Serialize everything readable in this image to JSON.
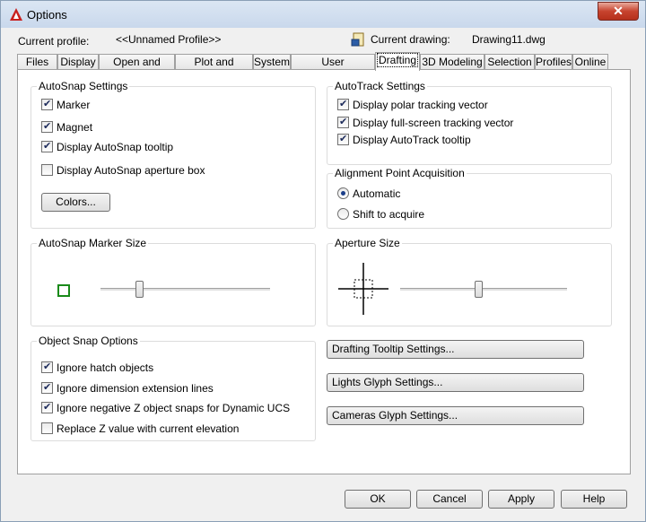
{
  "window": {
    "title": "Options",
    "close_glyph": "✕",
    "app_icon": "autocad-logo-icon"
  },
  "profile": {
    "current_profile_label": "Current profile:",
    "current_profile_value": "<<Unnamed Profile>>",
    "current_drawing_label": "Current drawing:",
    "current_drawing_value": "Drawing11.dwg"
  },
  "tabs": [
    {
      "label": "Files"
    },
    {
      "label": "Display"
    },
    {
      "label": "Open and Save"
    },
    {
      "label": "Plot and Publish"
    },
    {
      "label": "System"
    },
    {
      "label": "User Preferences"
    },
    {
      "label": "Drafting",
      "active": true
    },
    {
      "label": "3D Modeling"
    },
    {
      "label": "Selection"
    },
    {
      "label": "Profiles"
    },
    {
      "label": "Online"
    }
  ],
  "autosnap": {
    "title": "AutoSnap Settings",
    "marker": {
      "label": "Marker",
      "checked": true
    },
    "magnet": {
      "label": "Magnet",
      "checked": true
    },
    "tooltip": {
      "label": "Display AutoSnap tooltip",
      "checked": true
    },
    "aperture_box": {
      "label": "Display AutoSnap aperture box",
      "checked": false
    },
    "colors_button": "Colors..."
  },
  "autotrack": {
    "title": "AutoTrack Settings",
    "polar": {
      "label": "Display polar tracking vector",
      "checked": true
    },
    "fullscreen": {
      "label": "Display full-screen tracking vector",
      "checked": true
    },
    "tooltip": {
      "label": "Display AutoTrack tooltip",
      "checked": true
    }
  },
  "alignment": {
    "title": "Alignment Point Acquisition",
    "automatic": {
      "label": "Automatic",
      "selected": true
    },
    "shift": {
      "label": "Shift to acquire",
      "selected": false
    }
  },
  "marker_size": {
    "title": "AutoSnap Marker Size",
    "level": 0.23,
    "marker_color": "#1a8a1a"
  },
  "aperture_size": {
    "title": "Aperture Size",
    "level": 0.47
  },
  "object_snap": {
    "title": "Object Snap Options",
    "ignore_hatch": {
      "label": "Ignore hatch objects",
      "checked": true
    },
    "ignore_dimension": {
      "label": "Ignore dimension extension lines",
      "checked": true
    },
    "ignore_negative_z": {
      "label": "Ignore negative Z object snaps for Dynamic UCS",
      "checked": true
    },
    "replace_z": {
      "label": "Replace Z value with current elevation",
      "checked": false
    }
  },
  "buttons": {
    "drafting_tooltip": "Drafting Tooltip Settings...",
    "lights_glyph": "Lights Glyph Settings...",
    "cameras_glyph": "Cameras Glyph Settings..."
  },
  "footer": {
    "ok": "OK",
    "cancel": "Cancel",
    "apply": "Apply",
    "help": "Help"
  }
}
